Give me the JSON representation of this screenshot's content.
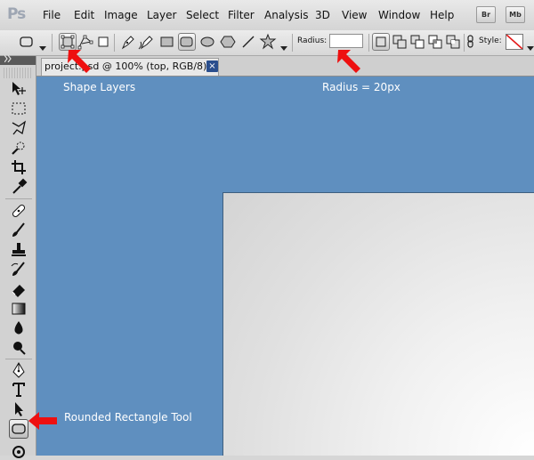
{
  "app": {
    "logo": "Ps"
  },
  "menubar": {
    "items": [
      "File",
      "Edit",
      "Image",
      "Layer",
      "Select",
      "Filter",
      "Analysis",
      "3D",
      "View",
      "Window",
      "Help"
    ],
    "right_buttons": [
      "Br",
      "Mb"
    ]
  },
  "options": {
    "radius_label": "Radius:",
    "radius_value": "",
    "style_label": "Style:"
  },
  "document": {
    "tab_title": "project.psd @ 100% (top, RGB/8) *",
    "tab_close": "×"
  },
  "annotations": {
    "shape_layers": "Shape Layers",
    "radius": "Radius = 20px",
    "rounded_rect_tool": "Rounded Rectangle Tool"
  },
  "colors": {
    "canvas_background": "#5f8fbf",
    "annotation_arrow": "#ee1010",
    "annotation_text": "#ffffff"
  }
}
